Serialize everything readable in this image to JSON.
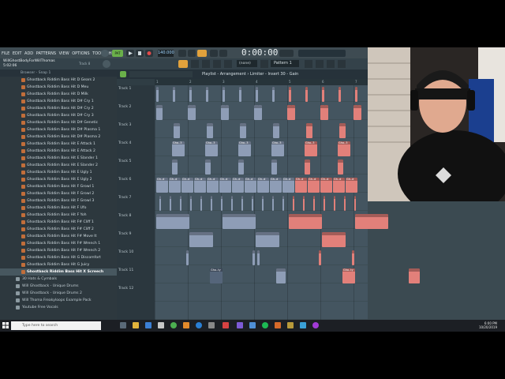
{
  "menu": {
    "items": [
      "FILE",
      "EDIT",
      "ADD",
      "PATTERNS",
      "VIEW",
      "OPTIONS",
      "TOOLS",
      "HELP"
    ]
  },
  "transport": {
    "mode": "PAT",
    "tempo": "140.000",
    "time": "0:00:00"
  },
  "project": {
    "name": "WillGhostBodyForWillThomas",
    "position": "5:02:06",
    "track": "Track 8"
  },
  "toolbar": {
    "snap": "(none)",
    "pattern": "Pattern 1"
  },
  "browser": {
    "header": "Browser - Snap 1",
    "samples": [
      "Ghostback Riddim Bass Hit D Gears 2",
      "Ghostback Riddim Bass Hit D Meu",
      "Ghostback Riddim Bass Hit D Milk",
      "Ghostback Riddim Bass Hit D# Cry 1",
      "Ghostback Riddim Bass Hit D# Cry 2",
      "Ghostback Riddim Bass Hit D# Cry 3",
      "Ghostback Riddim Bass Hit D# Genetic",
      "Ghostback Riddim Bass Hit D# Plasma 1",
      "Ghostback Riddim Bass Hit D# Plasma 2",
      "Ghostback Riddim Bass Hit E Attack 1",
      "Ghostback Riddim Bass Hit E Attack 2",
      "Ghostback Riddim Bass Hit E Slander 1",
      "Ghostback Riddim Bass Hit E Slander 2",
      "Ghostback Riddim Bass Hit E Ugly 1",
      "Ghostback Riddim Bass Hit E Ugly 2",
      "Ghostback Riddim Bass Hit F Growl 1",
      "Ghostback Riddim Bass Hit F Growl 2",
      "Ghostback Riddim Bass Hit F Growl 3",
      "Ghostback Riddim Bass Hit F Ufo",
      "Ghostback Riddim Bass Hit F Yoh",
      "Ghostback Riddim Bass Hit F# Cliff 1",
      "Ghostback Riddim Bass Hit F# Cliff 2",
      "Ghostback Riddim Bass Hit F# Move It",
      "Ghostback Riddim Bass Hit F# Wrench 1",
      "Ghostback Riddim Bass Hit F# Wrench 2",
      "Ghostback Riddim Bass Hit G Discomfort",
      "Ghostback Riddim Bass Hit G Juicy",
      "Ghostback Riddim Bass Hit X Screech"
    ],
    "folders": [
      "30 Hats & Cymbals",
      "Will Ghostback - Unique Drums",
      "Will Ghostback - Unique Drums 2",
      "Will Thoma Freakyloops Example Pack",
      "Youtube Free Vocals"
    ]
  },
  "playlist": {
    "title": "Playlist - Arrangement › Limiter - Insert 30 - Gain",
    "ruler": [
      "1",
      "2",
      "3",
      "4",
      "5",
      "6",
      "7"
    ],
    "tracks": [
      "Track 1",
      "Track 2",
      "Track 3",
      "Track 4",
      "Track 5",
      "Track 6",
      "Track 7",
      "Track 8",
      "Track 9",
      "Track 10",
      "Track 11",
      "Track 12"
    ],
    "clip_labels": {
      "t4": "Gho..3",
      "t6": "Gh..d",
      "t11": "Gho..ty"
    }
  },
  "taskbar": {
    "search_placeholder": "Type here to search",
    "time": "6:00 PM",
    "date": "10/20/2019"
  },
  "colors": {
    "accent": "#e2807a",
    "clip_blue": "#8e9db6",
    "playlist_bg": "#445560"
  }
}
